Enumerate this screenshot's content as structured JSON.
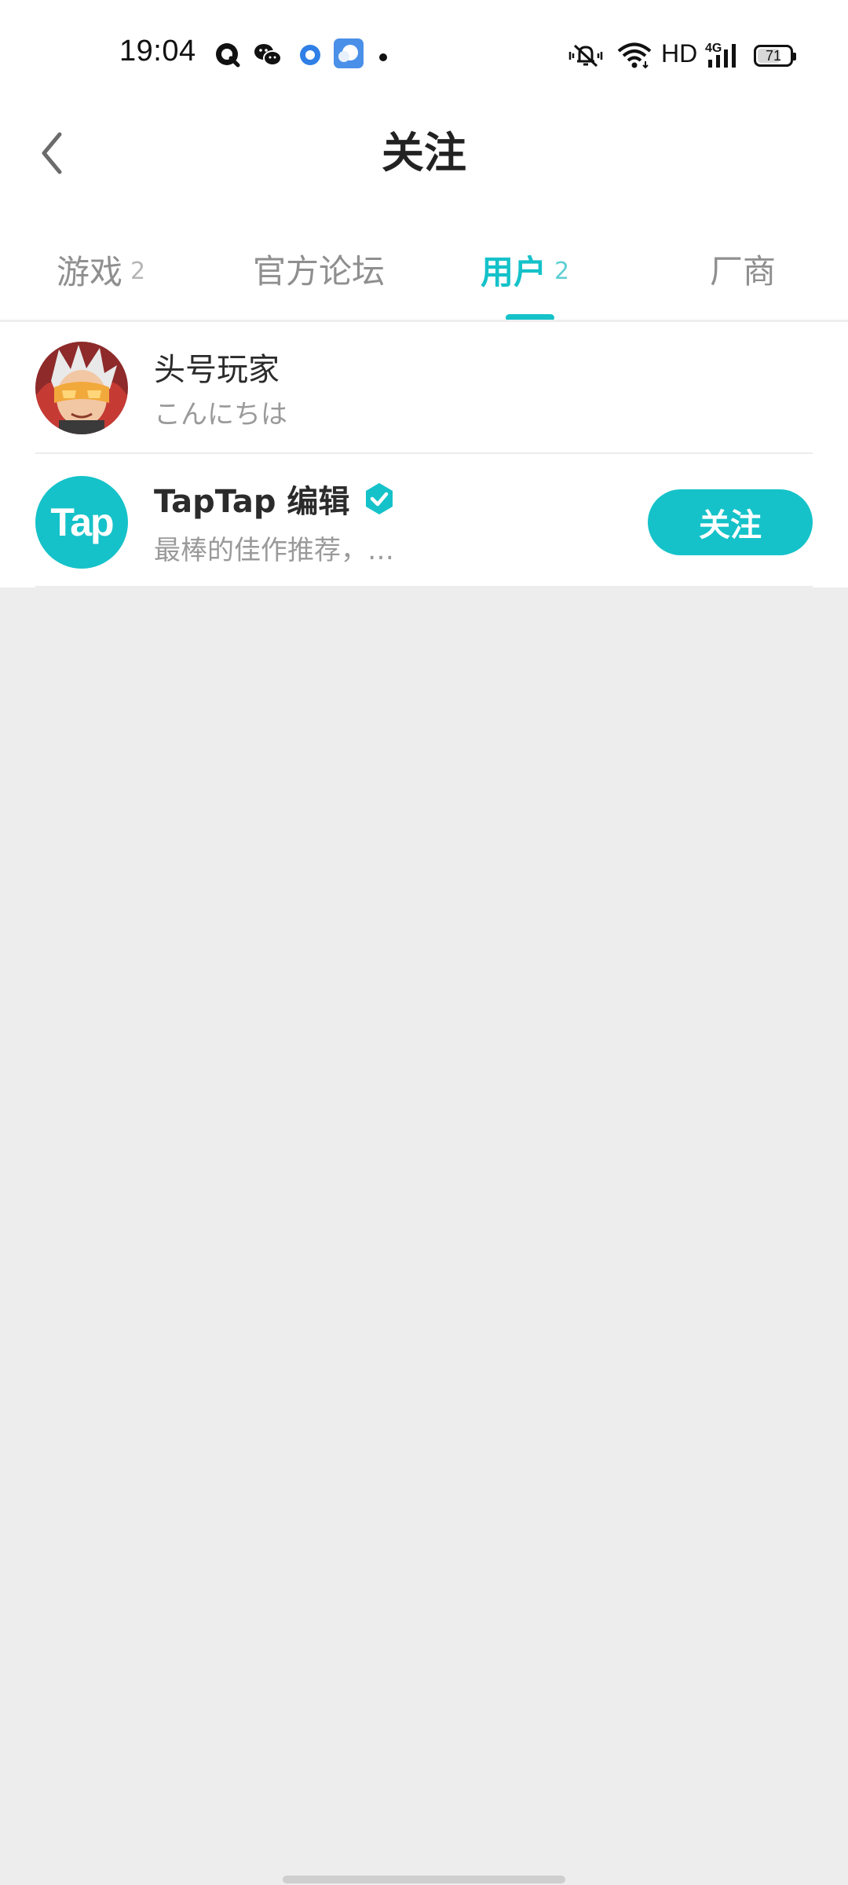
{
  "status_bar": {
    "time": "19:04",
    "network_label": "HD",
    "network_type": "4G",
    "battery_level": "71",
    "battery_fraction": 0.71,
    "notification_icons": [
      "qq-icon",
      "wechat-icon",
      "blue-circle-app-icon",
      "weather-app-icon",
      "more-dot-icon"
    ],
    "system_icons": [
      "vibrate-mute-icon",
      "wifi-icon",
      "signal-icon",
      "battery-icon"
    ]
  },
  "header": {
    "title": "关注"
  },
  "tabs": [
    {
      "label": "游戏",
      "count": "2"
    },
    {
      "label": "官方论坛",
      "count": ""
    },
    {
      "label": "用户",
      "count": "2",
      "active": true
    },
    {
      "label": "厂商",
      "count": ""
    }
  ],
  "users": [
    {
      "name": "头号玩家",
      "bio": "こんにちは",
      "verified": false
    },
    {
      "name": "TapTap 编辑",
      "bio": "最棒的佳作推荐，…",
      "verified": true,
      "follow_label": "关注",
      "avatar_text": "Tap"
    }
  ],
  "colors": {
    "accent": "#15c2c9",
    "background": "#ededed",
    "inactive_tab": "#8f8f8f"
  }
}
